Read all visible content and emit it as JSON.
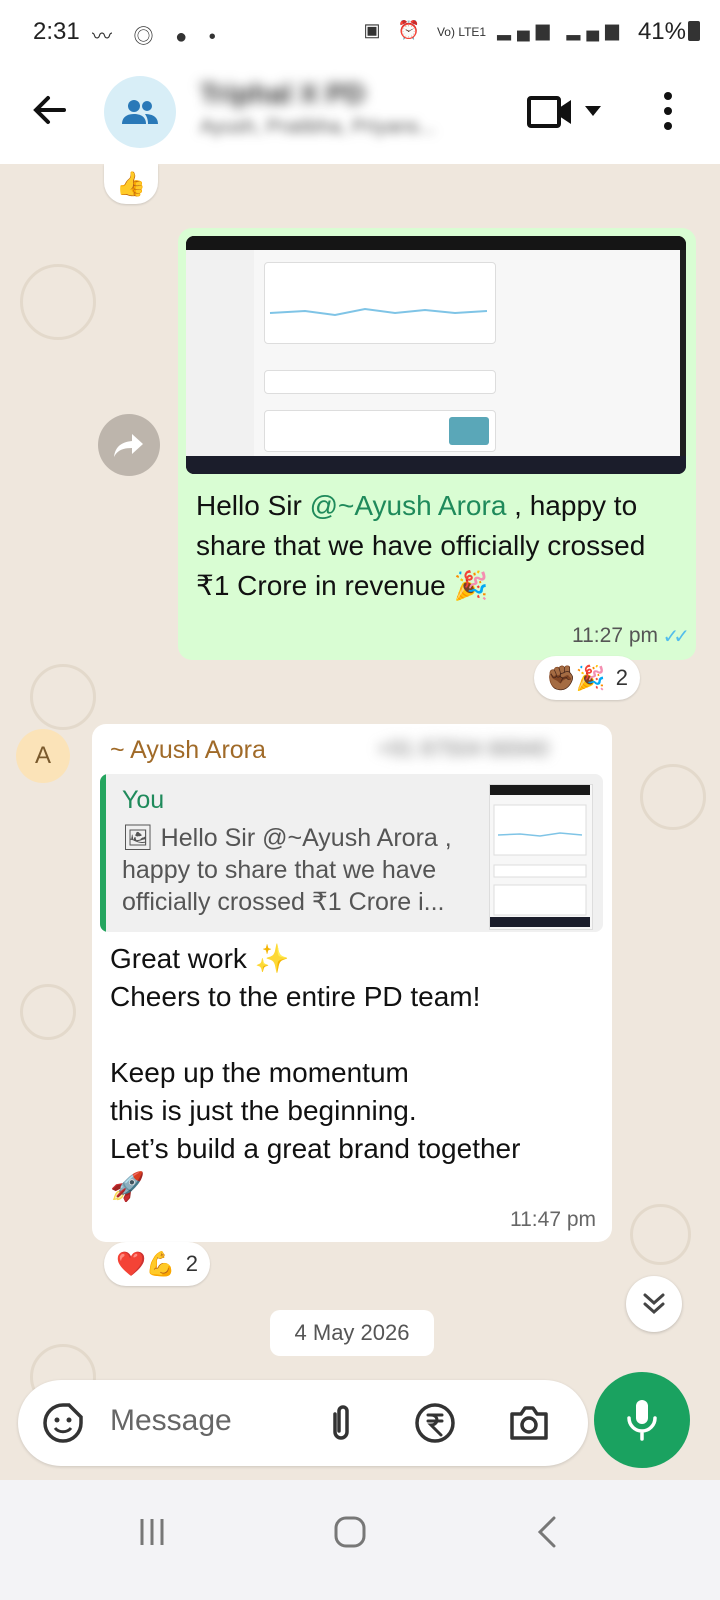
{
  "status_bar": {
    "time": "2:31",
    "battery": "41%",
    "network": "Vo) LTE1"
  },
  "header": {
    "title": "Triphal X PD",
    "subtitle": "Ayush, Pratibha, Priyans..."
  },
  "messages": {
    "outgoing": {
      "text_before": "Hello Sir ",
      "mention": "@~Ayush Arora",
      "text_after": " , happy to share that we have officially crossed ₹1 Crore in revenue 🎉",
      "time": "11:27 pm",
      "reactions": "✊🏾🎉",
      "reaction_count": "2"
    },
    "incoming": {
      "avatar_letter": "A",
      "sender": "~ Ayush Arora",
      "phone": "+91 87504 66940",
      "quote_author": "You",
      "quote_text": "🖼 Hello Sir @~Ayush Arora , happy to share that we have officially crossed ₹1 Crore i...",
      "body": "Great work ✨\nCheers to the entire PD team!\n\nKeep up the momentum\nthis is just the beginning.\nLet’s build a great brand together\n🚀",
      "time": "11:47 pm",
      "reactions": "❤️💪",
      "reaction_count": "2"
    },
    "top_reaction": "👍"
  },
  "date_chip": "4 May 2026",
  "input": {
    "placeholder": "Message"
  },
  "colors": {
    "accent": "#1aa260",
    "outgoing_bubble": "#d9fdd3",
    "mention": "#1f8a5b",
    "sender_name": "#a06a28",
    "read_ticks": "#53bdeb"
  }
}
